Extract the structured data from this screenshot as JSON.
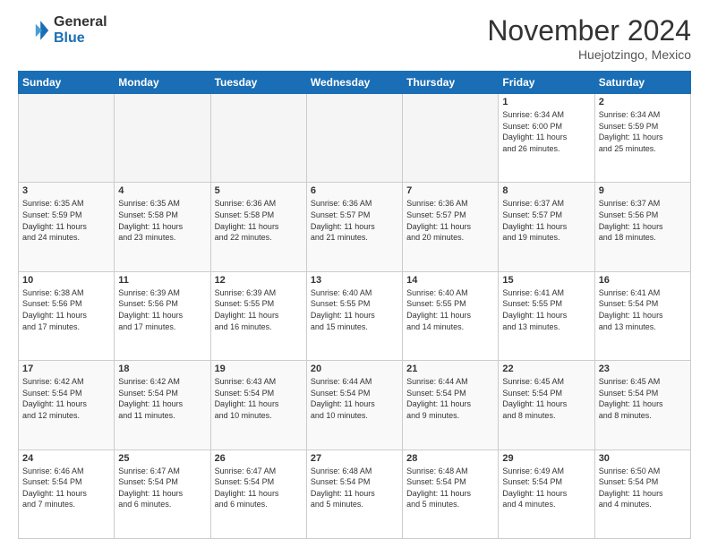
{
  "header": {
    "logo_line1": "General",
    "logo_line2": "Blue",
    "month": "November 2024",
    "location": "Huejotzingo, Mexico"
  },
  "weekdays": [
    "Sunday",
    "Monday",
    "Tuesday",
    "Wednesday",
    "Thursday",
    "Friday",
    "Saturday"
  ],
  "weeks": [
    [
      {
        "day": "",
        "info": ""
      },
      {
        "day": "",
        "info": ""
      },
      {
        "day": "",
        "info": ""
      },
      {
        "day": "",
        "info": ""
      },
      {
        "day": "",
        "info": ""
      },
      {
        "day": "1",
        "info": "Sunrise: 6:34 AM\nSunset: 6:00 PM\nDaylight: 11 hours\nand 26 minutes."
      },
      {
        "day": "2",
        "info": "Sunrise: 6:34 AM\nSunset: 5:59 PM\nDaylight: 11 hours\nand 25 minutes."
      }
    ],
    [
      {
        "day": "3",
        "info": "Sunrise: 6:35 AM\nSunset: 5:59 PM\nDaylight: 11 hours\nand 24 minutes."
      },
      {
        "day": "4",
        "info": "Sunrise: 6:35 AM\nSunset: 5:58 PM\nDaylight: 11 hours\nand 23 minutes."
      },
      {
        "day": "5",
        "info": "Sunrise: 6:36 AM\nSunset: 5:58 PM\nDaylight: 11 hours\nand 22 minutes."
      },
      {
        "day": "6",
        "info": "Sunrise: 6:36 AM\nSunset: 5:57 PM\nDaylight: 11 hours\nand 21 minutes."
      },
      {
        "day": "7",
        "info": "Sunrise: 6:36 AM\nSunset: 5:57 PM\nDaylight: 11 hours\nand 20 minutes."
      },
      {
        "day": "8",
        "info": "Sunrise: 6:37 AM\nSunset: 5:57 PM\nDaylight: 11 hours\nand 19 minutes."
      },
      {
        "day": "9",
        "info": "Sunrise: 6:37 AM\nSunset: 5:56 PM\nDaylight: 11 hours\nand 18 minutes."
      }
    ],
    [
      {
        "day": "10",
        "info": "Sunrise: 6:38 AM\nSunset: 5:56 PM\nDaylight: 11 hours\nand 17 minutes."
      },
      {
        "day": "11",
        "info": "Sunrise: 6:39 AM\nSunset: 5:56 PM\nDaylight: 11 hours\nand 17 minutes."
      },
      {
        "day": "12",
        "info": "Sunrise: 6:39 AM\nSunset: 5:55 PM\nDaylight: 11 hours\nand 16 minutes."
      },
      {
        "day": "13",
        "info": "Sunrise: 6:40 AM\nSunset: 5:55 PM\nDaylight: 11 hours\nand 15 minutes."
      },
      {
        "day": "14",
        "info": "Sunrise: 6:40 AM\nSunset: 5:55 PM\nDaylight: 11 hours\nand 14 minutes."
      },
      {
        "day": "15",
        "info": "Sunrise: 6:41 AM\nSunset: 5:55 PM\nDaylight: 11 hours\nand 13 minutes."
      },
      {
        "day": "16",
        "info": "Sunrise: 6:41 AM\nSunset: 5:54 PM\nDaylight: 11 hours\nand 13 minutes."
      }
    ],
    [
      {
        "day": "17",
        "info": "Sunrise: 6:42 AM\nSunset: 5:54 PM\nDaylight: 11 hours\nand 12 minutes."
      },
      {
        "day": "18",
        "info": "Sunrise: 6:42 AM\nSunset: 5:54 PM\nDaylight: 11 hours\nand 11 minutes."
      },
      {
        "day": "19",
        "info": "Sunrise: 6:43 AM\nSunset: 5:54 PM\nDaylight: 11 hours\nand 10 minutes."
      },
      {
        "day": "20",
        "info": "Sunrise: 6:44 AM\nSunset: 5:54 PM\nDaylight: 11 hours\nand 10 minutes."
      },
      {
        "day": "21",
        "info": "Sunrise: 6:44 AM\nSunset: 5:54 PM\nDaylight: 11 hours\nand 9 minutes."
      },
      {
        "day": "22",
        "info": "Sunrise: 6:45 AM\nSunset: 5:54 PM\nDaylight: 11 hours\nand 8 minutes."
      },
      {
        "day": "23",
        "info": "Sunrise: 6:45 AM\nSunset: 5:54 PM\nDaylight: 11 hours\nand 8 minutes."
      }
    ],
    [
      {
        "day": "24",
        "info": "Sunrise: 6:46 AM\nSunset: 5:54 PM\nDaylight: 11 hours\nand 7 minutes."
      },
      {
        "day": "25",
        "info": "Sunrise: 6:47 AM\nSunset: 5:54 PM\nDaylight: 11 hours\nand 6 minutes."
      },
      {
        "day": "26",
        "info": "Sunrise: 6:47 AM\nSunset: 5:54 PM\nDaylight: 11 hours\nand 6 minutes."
      },
      {
        "day": "27",
        "info": "Sunrise: 6:48 AM\nSunset: 5:54 PM\nDaylight: 11 hours\nand 5 minutes."
      },
      {
        "day": "28",
        "info": "Sunrise: 6:48 AM\nSunset: 5:54 PM\nDaylight: 11 hours\nand 5 minutes."
      },
      {
        "day": "29",
        "info": "Sunrise: 6:49 AM\nSunset: 5:54 PM\nDaylight: 11 hours\nand 4 minutes."
      },
      {
        "day": "30",
        "info": "Sunrise: 6:50 AM\nSunset: 5:54 PM\nDaylight: 11 hours\nand 4 minutes."
      }
    ]
  ]
}
